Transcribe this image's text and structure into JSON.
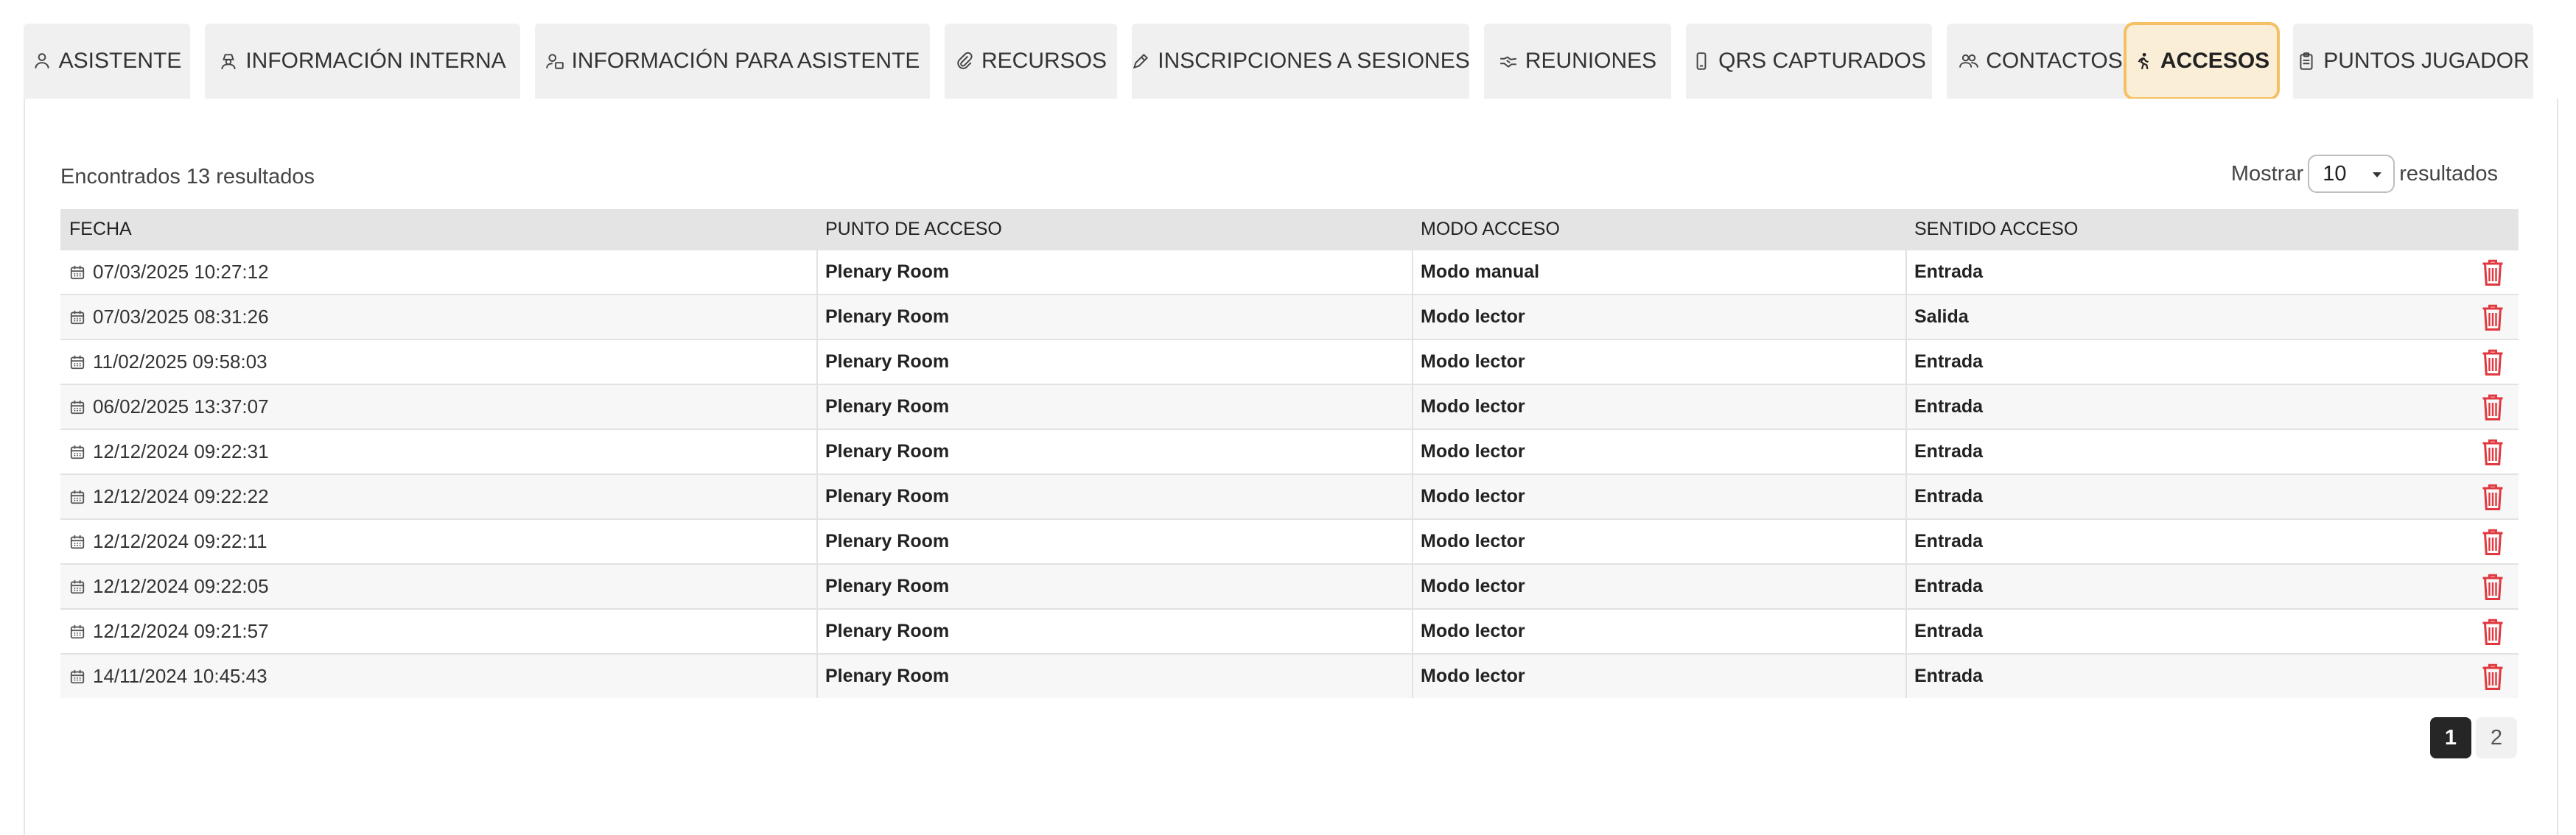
{
  "tabs": [
    {
      "label": "ASISTENTE",
      "icon": "person-icon"
    },
    {
      "label": "INFORMACIÓN INTERNA",
      "icon": "user-secret-icon"
    },
    {
      "label": "INFORMACIÓN PARA ASISTENTE",
      "icon": "user-info-icon"
    },
    {
      "label": "RECURSOS",
      "icon": "paperclip-icon"
    },
    {
      "label": "INSCRIPCIONES A SESIONES",
      "icon": "pen-icon"
    },
    {
      "label": "REUNIONES",
      "icon": "handshake-icon"
    },
    {
      "label": "QRS CAPTURADOS",
      "icon": "mobile-icon"
    },
    {
      "label": "CONTACTOS",
      "icon": "users-icon"
    },
    {
      "label": "ACCESOS",
      "icon": "walking-icon",
      "active": true
    },
    {
      "label": "PUNTOS JUGADOR",
      "icon": "clipboard-icon"
    }
  ],
  "summary": "Encontrados 13 resultados",
  "page_size": {
    "before": "Mostrar",
    "value": "10",
    "after": "resultados"
  },
  "table": {
    "headers": [
      "FECHA",
      "PUNTO DE ACCESO",
      "MODO ACCESO",
      "SENTIDO ACCESO"
    ],
    "rows": [
      {
        "fecha": "07/03/2025 10:27:12",
        "punto": "Plenary Room",
        "modo": "Modo manual",
        "sentido": "Entrada"
      },
      {
        "fecha": "07/03/2025 08:31:26",
        "punto": "Plenary Room",
        "modo": "Modo lector",
        "sentido": "Salida"
      },
      {
        "fecha": "11/02/2025 09:58:03",
        "punto": "Plenary Room",
        "modo": "Modo lector",
        "sentido": "Entrada"
      },
      {
        "fecha": "06/02/2025 13:37:07",
        "punto": "Plenary Room",
        "modo": "Modo lector",
        "sentido": "Entrada"
      },
      {
        "fecha": "12/12/2024 09:22:31",
        "punto": "Plenary Room",
        "modo": "Modo lector",
        "sentido": "Entrada"
      },
      {
        "fecha": "12/12/2024 09:22:22",
        "punto": "Plenary Room",
        "modo": "Modo lector",
        "sentido": "Entrada"
      },
      {
        "fecha": "12/12/2024 09:22:11",
        "punto": "Plenary Room",
        "modo": "Modo lector",
        "sentido": "Entrada"
      },
      {
        "fecha": "12/12/2024 09:22:05",
        "punto": "Plenary Room",
        "modo": "Modo lector",
        "sentido": "Entrada"
      },
      {
        "fecha": "12/12/2024 09:21:57",
        "punto": "Plenary Room",
        "modo": "Modo lector",
        "sentido": "Entrada"
      },
      {
        "fecha": "14/11/2024 10:45:43",
        "punto": "Plenary Room",
        "modo": "Modo lector",
        "sentido": "Entrada"
      }
    ]
  },
  "pagination": {
    "pages": [
      "1",
      "2"
    ],
    "current": "1"
  },
  "colors": {
    "active_tab_bg": "#fbeed7",
    "active_tab_border": "#f5c063",
    "delete_red": "#e0383e",
    "page_active": "#262626"
  }
}
